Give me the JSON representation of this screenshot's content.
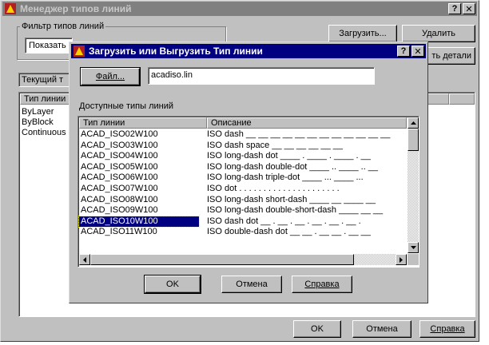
{
  "main": {
    "title": "Менеджер типов линий",
    "help_btn": "?",
    "close_btn": "✕",
    "filter_group": "Фильтр типов линий",
    "filter_value": "Показать",
    "load_btn": "Загрузить...",
    "delete_btn": "Удалить",
    "details_btn": "ть детали",
    "current_label": "Текущий т",
    "list_header": "Тип линии",
    "list_items": [
      "ByLayer",
      "ByBlock",
      "Continuous"
    ],
    "ok_btn": "OK",
    "cancel_btn": "Отмена",
    "help_label": "Справка"
  },
  "dialog": {
    "title": "Загрузить или Выгрузить Тип линии",
    "help_btn": "?",
    "close_btn": "✕",
    "file_btn": "Файл...",
    "file_value": "acadiso.lin",
    "available_label": "Доступные типы линий",
    "col_type": "Тип линии",
    "col_desc": "Описание",
    "rows": [
      {
        "name": "ACAD_ISO02W100",
        "desc": "ISO dash __ __ __ __ __ __ __ __ __ __ __ __"
      },
      {
        "name": "ACAD_ISO03W100",
        "desc": "ISO dash space __   __   __   __   __   __"
      },
      {
        "name": "ACAD_ISO04W100",
        "desc": "ISO long-dash dot ____ . ____ . ____ . __"
      },
      {
        "name": "ACAD_ISO05W100",
        "desc": "ISO long-dash double-dot ____ .. ____ .. __"
      },
      {
        "name": "ACAD_ISO06W100",
        "desc": "ISO long-dash triple-dot ____ ... ____ ..."
      },
      {
        "name": "ACAD_ISO07W100",
        "desc": "ISO dot . . . . . . . . . . . . . . . . . . . . ."
      },
      {
        "name": "ACAD_ISO08W100",
        "desc": "ISO long-dash short-dash ____ __ ____ __"
      },
      {
        "name": "ACAD_ISO09W100",
        "desc": "ISO long-dash double-short-dash ____ __ __"
      },
      {
        "name": "ACAD_ISO10W100",
        "desc": "ISO dash dot __ . __ . __ . __ . __ . __ ."
      },
      {
        "name": "ACAD_ISO11W100",
        "desc": "ISO double-dash dot __ __ . __ __ . __ __"
      }
    ],
    "selected_index": 8,
    "ok_btn": "OK",
    "cancel_btn": "Отмена",
    "help_label": "Справка"
  },
  "colors": {
    "active_title": "#000080",
    "inactive_title": "#808080",
    "face": "#c0c0c0",
    "selection": "#000080"
  }
}
